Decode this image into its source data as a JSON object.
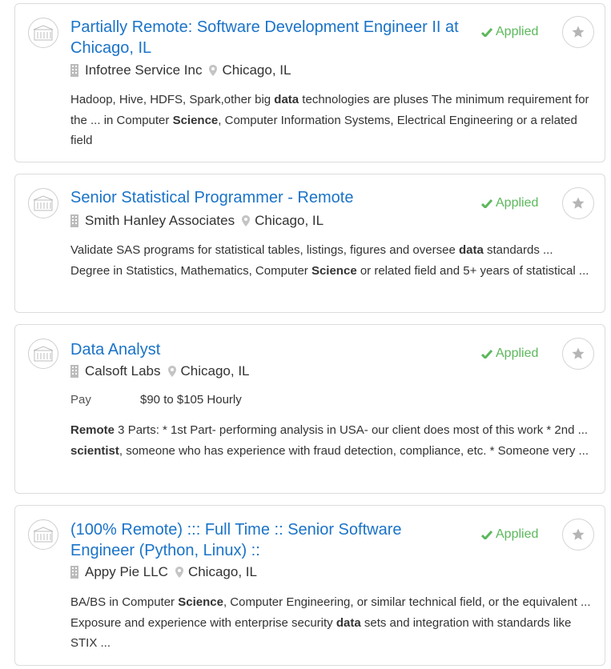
{
  "status_color": "#5cb85c",
  "link_color": "#1a73c8",
  "jobs": [
    {
      "title": "Partially Remote: Software Development Engineer II at Chicago, IL",
      "company": "Infotree Service Inc",
      "location": "Chicago, IL",
      "status": "Applied",
      "snippet": [
        {
          "t": "Hadoop, Hive, HDFS, Spark,other big "
        },
        {
          "t": "data",
          "b": true
        },
        {
          "t": " technologies are pluses The minimum requirement for the ... in Computer "
        },
        {
          "t": "Science",
          "b": true
        },
        {
          "t": ", Computer Information Systems, Electrical Engineering or a related field"
        }
      ]
    },
    {
      "title": "Senior Statistical Programmer - Remote",
      "company": "Smith Hanley Associates",
      "location": "Chicago, IL",
      "status": "Applied",
      "snippet": [
        {
          "t": "Validate SAS programs for statistical tables, listings, figures and oversee "
        },
        {
          "t": "data",
          "b": true
        },
        {
          "t": " standards ... Degree in Statistics, Mathematics, Computer "
        },
        {
          "t": "Science",
          "b": true
        },
        {
          "t": " or related field and 5+ years of statistical ..."
        }
      ]
    },
    {
      "title": "Data Analyst",
      "company": "Calsoft Labs",
      "location": "Chicago, IL",
      "status": "Applied",
      "pay_label": "Pay",
      "pay_value": "$90 to $105 Hourly",
      "snippet": [
        {
          "t": "Remote",
          "b": true
        },
        {
          "t": " 3 Parts: * 1st Part- performing analysis in USA- our client does most of this work * 2nd ... "
        },
        {
          "t": "scientist",
          "b": true
        },
        {
          "t": ", someone who has experience with fraud detection, compliance, etc. * Someone very ..."
        }
      ]
    },
    {
      "title": "(100% Remote) ::: Full Time :: Senior Software Engineer (Python, Linux) ::",
      "company": "Appy Pie LLC",
      "location": "Chicago, IL",
      "status": "Applied",
      "snippet": [
        {
          "t": "BA/BS in Computer "
        },
        {
          "t": "Science",
          "b": true
        },
        {
          "t": ", Computer Engineering, or similar technical field, or the equivalent ... Exposure and experience with enterprise security "
        },
        {
          "t": "data",
          "b": true
        },
        {
          "t": " sets and integration with standards like STIX ..."
        }
      ]
    }
  ]
}
